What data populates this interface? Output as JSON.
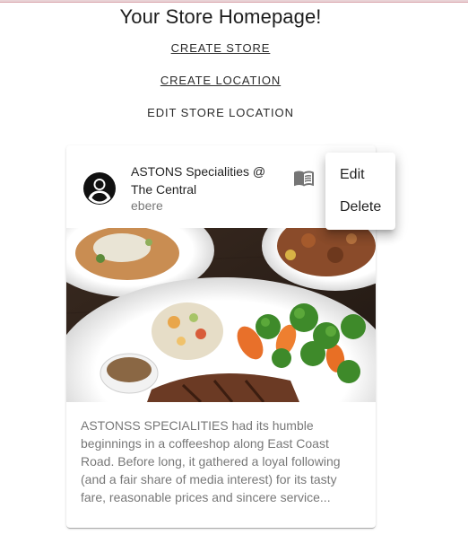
{
  "page": {
    "title": "Your Store Homepage!"
  },
  "nav": {
    "create_store": "CREATE STORE",
    "create_location": "CREATE LOCATION",
    "edit_store_location": "EDIT STORE LOCATION"
  },
  "store_card": {
    "title": "ASTONS Specialities @ The Central",
    "subheader": "ebere",
    "description": "ASTONSS SPECIALITIES had its humble beginnings in a coffeeshop along East Coast Road. Before long, it gathered a loyal following (and a fair share of media interest) for its tasty fare, reasonable prices and sincere service...",
    "avatar_icon": "account-circle-icon",
    "action_icon": "menu-book-icon",
    "image_icon": "food-plate-image"
  },
  "menu": {
    "items": [
      "Edit",
      "Delete"
    ]
  },
  "colors": {
    "top_line": "#e9d3d6",
    "text_primary": "#1d1d1d",
    "text_secondary": "#757575"
  }
}
